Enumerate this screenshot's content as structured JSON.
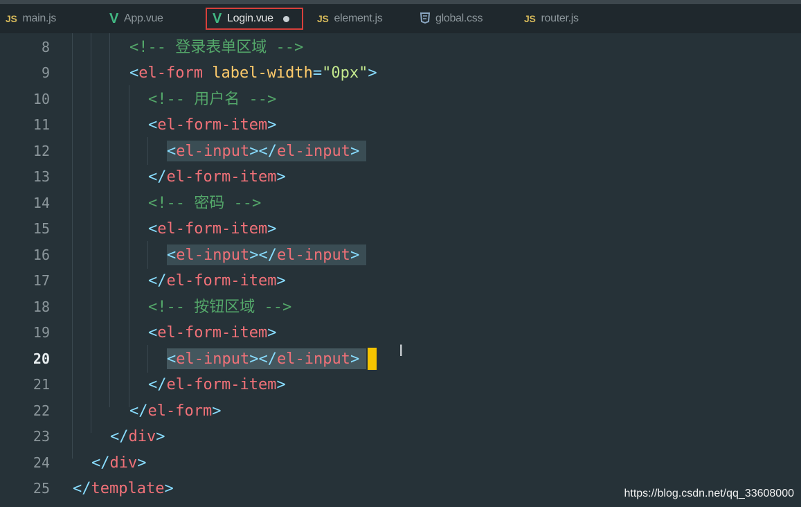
{
  "tabs": [
    {
      "icon": "JS",
      "label": "main.js"
    },
    {
      "icon": "V",
      "label": "App.vue"
    },
    {
      "icon": "V",
      "label": "Login.vue"
    },
    {
      "icon": "JS",
      "label": "element.js"
    },
    {
      "icon": "css-icon",
      "label": "global.css"
    },
    {
      "icon": "JS",
      "label": "router.js"
    }
  ],
  "lines": [
    {
      "num": "8",
      "parts": [
        "<!-- ",
        "登录表单区域",
        " -->"
      ]
    },
    {
      "num": "9",
      "parts": [
        "<",
        "el-form",
        " ",
        "label-width",
        "=",
        "\"0px\"",
        ">"
      ]
    },
    {
      "num": "10",
      "parts": [
        "<!-- ",
        "用户名",
        " -->"
      ]
    },
    {
      "num": "11",
      "parts": [
        "<",
        "el-form-item",
        ">"
      ]
    },
    {
      "num": "12",
      "parts": [
        "<",
        "el-input",
        ">",
        "</",
        "el-input",
        ">"
      ]
    },
    {
      "num": "13",
      "parts": [
        "</",
        "el-form-item",
        ">"
      ]
    },
    {
      "num": "14",
      "parts": [
        "<!-- ",
        "密码",
        " -->"
      ]
    },
    {
      "num": "15",
      "parts": [
        "<",
        "el-form-item",
        ">"
      ]
    },
    {
      "num": "16",
      "parts": [
        "<",
        "el-input",
        ">",
        "</",
        "el-input",
        ">"
      ]
    },
    {
      "num": "17",
      "parts": [
        "</",
        "el-form-item",
        ">"
      ]
    },
    {
      "num": "18",
      "parts": [
        "<!-- ",
        "按钮区域",
        " -->"
      ]
    },
    {
      "num": "19",
      "parts": [
        "<",
        "el-form-item",
        ">"
      ]
    },
    {
      "num": "20",
      "parts": [
        "<",
        "el-input",
        ">",
        "</",
        "el-input",
        ">"
      ]
    },
    {
      "num": "21",
      "parts": [
        "</",
        "el-form-item",
        ">"
      ]
    },
    {
      "num": "22",
      "parts": [
        "</",
        "el-form",
        ">"
      ]
    },
    {
      "num": "23",
      "parts": [
        "</",
        "div",
        ">"
      ]
    },
    {
      "num": "24",
      "parts": [
        "</",
        "div",
        ">"
      ]
    },
    {
      "num": "25",
      "parts": [
        "</",
        "template",
        ">"
      ]
    }
  ],
  "current_line": "20",
  "watermark": "https://blog.csdn.net/qq_33608000",
  "colors": {
    "background": "#263238",
    "tag": "#f07178",
    "punctuation": "#89ddff",
    "attribute": "#ffcb6b",
    "string": "#c3e88d",
    "comment": "#54a86a",
    "cursor": "#f5c400",
    "active_tab_border": "#d8403b"
  }
}
